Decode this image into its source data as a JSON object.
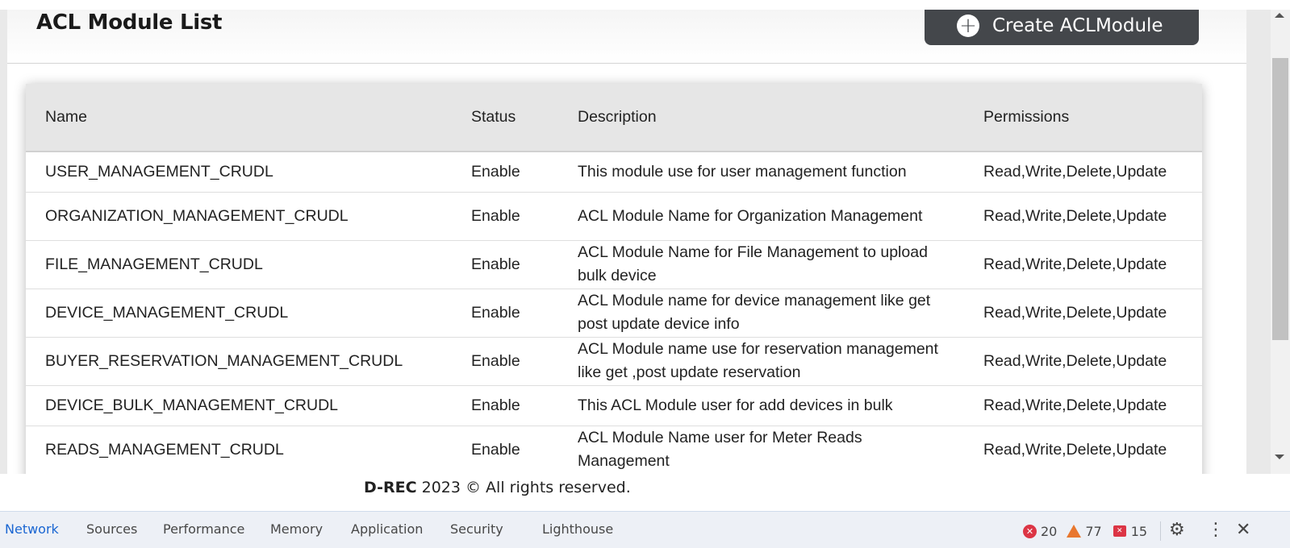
{
  "page": {
    "title": "ACL Module List",
    "create_button": {
      "icon": "plus-circle-icon",
      "label": "Create ACLModule"
    }
  },
  "table": {
    "columns": [
      "Name",
      "Status",
      "Description",
      "Permissions"
    ],
    "rows": [
      {
        "name": "USER_MANAGEMENT_CRUDL",
        "status": "Enable",
        "description": "This module use for user management function",
        "permissions": "Read,Write,Delete,Update"
      },
      {
        "name": "ORGANIZATION_MANAGEMENT_CRUDL",
        "status": "Enable",
        "description": "ACL Module Name for Organization Management",
        "permissions": "Read,Write,Delete,Update"
      },
      {
        "name": "FILE_MANAGEMENT_CRUDL",
        "status": "Enable",
        "description": "ACL Module Name for File Management to upload bulk device",
        "permissions": "Read,Write,Delete,Update"
      },
      {
        "name": "DEVICE_MANAGEMENT_CRUDL",
        "status": "Enable",
        "description": "ACL Module name for device management like get post update device info",
        "permissions": "Read,Write,Delete,Update"
      },
      {
        "name": "BUYER_RESERVATION_MANAGEMENT_CRUDL",
        "status": "Enable",
        "description": "ACL Module name use for reservation management like get ,post update reservation",
        "permissions": "Read,Write,Delete,Update"
      },
      {
        "name": "DEVICE_BULK_MANAGEMENT_CRUDL",
        "status": "Enable",
        "description": "This ACL Module user for add devices in bulk",
        "permissions": "Read,Write,Delete,Update"
      },
      {
        "name": "READS_MANAGEMENT_CRUDL",
        "status": "Enable",
        "description": "ACL Module Name user for Meter Reads Management",
        "permissions": "Read,Write,Delete,Update"
      }
    ]
  },
  "footer": {
    "brand": "D-REC",
    "text": " 2023 © All rights reserved."
  },
  "devtools": {
    "tabs": [
      {
        "label": "Network",
        "active": true
      },
      {
        "label": "Sources",
        "active": false
      },
      {
        "label": "Performance",
        "active": false
      },
      {
        "label": "Memory",
        "active": false
      },
      {
        "label": "Application",
        "active": false
      },
      {
        "label": "Security",
        "active": false
      },
      {
        "label": "Lighthouse",
        "active": false
      }
    ],
    "errors": "20",
    "warnings": "77",
    "issues": "15",
    "colors": {
      "active_tab": "#1a66d2",
      "error": "#dc3545",
      "warning": "#e8772e"
    }
  }
}
